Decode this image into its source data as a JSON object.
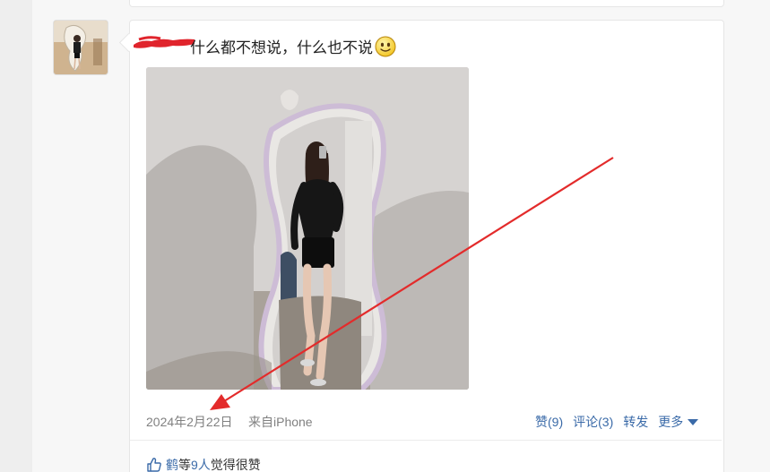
{
  "post": {
    "text": "什么都不想说，什么也不说",
    "date": "2024年2月22日",
    "source": "来自iPhone"
  },
  "actions": {
    "like": "赞(9)",
    "comment": "评论(3)",
    "repost": "转发",
    "more": "更多"
  },
  "likes": {
    "name": "鹤",
    "mid": " 等",
    "count": "9人",
    "suffix": "觉得很赞"
  },
  "colors": {
    "link": "#3a6aa8",
    "annotation_arrow": "#e32b2b",
    "redaction": "#e0242c"
  },
  "icons": {
    "emoji": "smiley-face-icon",
    "thumb": "thumbs-up-icon",
    "more": "chevron-down-icon"
  }
}
